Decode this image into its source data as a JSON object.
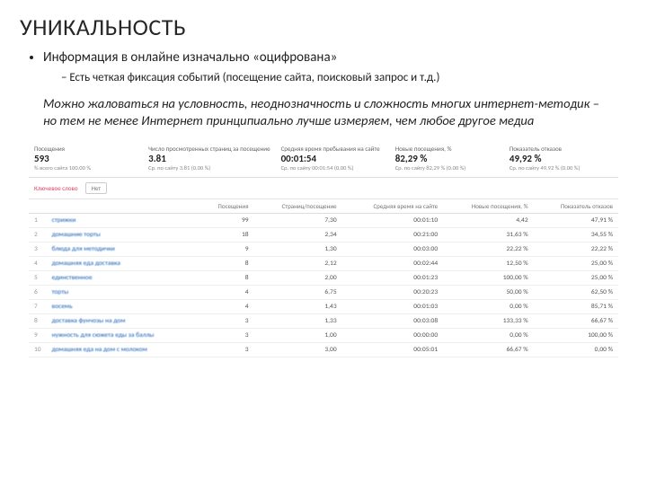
{
  "title": "УНИКАЛЬНОСТЬ",
  "bullet1": "Информация в онлайне изначально «оцифрована»",
  "bullet1_sub": "Есть четкая фиксация событий (посещение сайта, поисковый запрос и т.д.)",
  "paragraph": "Можно жаловаться на условность, неоднозначность и сложность многих интернет-методик – но тем не менее Интернет принципиально лучше измеряем, чем любое другое медиа",
  "metrics": [
    {
      "label": "Посещения",
      "value": "593",
      "sub": "% всего сайта 100.00 %"
    },
    {
      "label": "Число просмотренных страниц за посещение",
      "value": "3.81",
      "sub": "Ср. по сайту 3.81 (0.00 %)"
    },
    {
      "label": "Средняя время пребывания на сайте",
      "value": "00:01:54",
      "sub": "Ср. по сайту 00:01:54 (0.00 %)"
    },
    {
      "label": "Новые посещения, %",
      "value": "82,29 %",
      "sub": "Ср. по сайту 82,29 % (0.00 %)"
    },
    {
      "label": "Показатель отказов",
      "value": "49,92 %",
      "sub": "Ср. по сайту 49,92 % (0.00 %)"
    }
  ],
  "tab_label": "Ключевое слово",
  "tab_toggle": "Нет",
  "columns": [
    "",
    "",
    "Посещения",
    "Страниц/посещение",
    "Средняя время на сайте",
    "Новые посещения, %",
    "Показатель отказов"
  ],
  "rows": [
    {
      "n": "1",
      "kw": "стрижки",
      "v": "99",
      "pp": "7,30",
      "t": "00:01:10",
      "np": "4,42",
      "br": "47,91 %"
    },
    {
      "n": "2",
      "kw": "домашние торты",
      "v": "18",
      "pp": "2,34",
      "t": "00:21:00",
      "np": "31,63 %",
      "br": "34,55 %"
    },
    {
      "n": "3",
      "kw": "блюда для методички",
      "v": "9",
      "pp": "1,30",
      "t": "00:03:00",
      "np": "22,22 %",
      "br": "22,22 %"
    },
    {
      "n": "4",
      "kw": "домашняя еда доставка",
      "v": "8",
      "pp": "2,12",
      "t": "00:02:44",
      "np": "12,50 %",
      "br": "25,00 %"
    },
    {
      "n": "5",
      "kw": "единственное",
      "v": "8",
      "pp": "2,00",
      "t": "00:01:23",
      "np": "100,00 %",
      "br": "25,00 %"
    },
    {
      "n": "6",
      "kw": "торты",
      "v": "4",
      "pp": "6,75",
      "t": "00:20:23",
      "np": "50,00 %",
      "br": "62,50 %"
    },
    {
      "n": "7",
      "kw": "восемь",
      "v": "4",
      "pp": "1,43",
      "t": "00:01:03",
      "np": "0,00 %",
      "br": "85,71 %"
    },
    {
      "n": "8",
      "kw": "доставка фунчозы на дом",
      "v": "3",
      "pp": "1,33",
      "t": "00:03:08",
      "np": "133,33 %",
      "br": "66,67 %"
    },
    {
      "n": "9",
      "kw": "нужность для сюжета еды за баллы",
      "v": "3",
      "pp": "1,00",
      "t": "00:00:00",
      "np": "0,00 %",
      "br": "100,00 %"
    },
    {
      "n": "10",
      "kw": "домашняя еда на дом с молоком",
      "v": "3",
      "pp": "3,00",
      "t": "00:05:01",
      "np": "66,67 %",
      "br": "0,00 %"
    }
  ]
}
